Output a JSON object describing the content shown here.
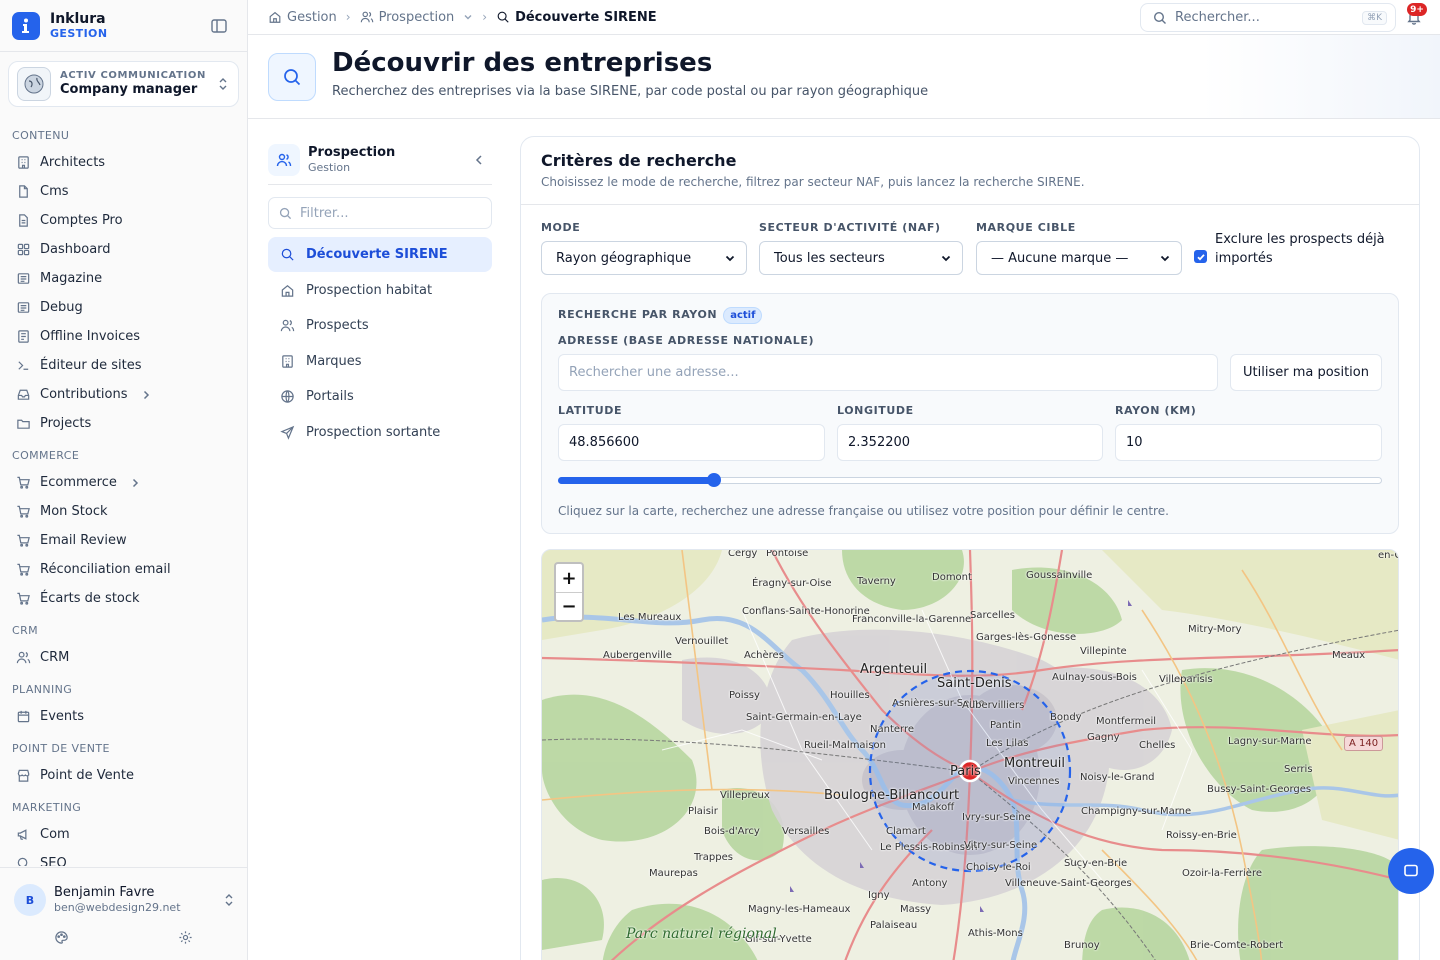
{
  "brand": {
    "name": "Inklura",
    "sub": "GESTION"
  },
  "org": {
    "kicker": "ACTIV COMMUNICATION",
    "name": "Company manager"
  },
  "sidebar": {
    "sections": [
      {
        "title": "CONTENU",
        "items": [
          {
            "label": "Architects",
            "icon": "building-icon"
          },
          {
            "label": "Cms",
            "icon": "file-icon"
          },
          {
            "label": "Comptes Pro",
            "icon": "file-text-icon"
          },
          {
            "label": "Dashboard",
            "icon": "dashboard-icon"
          },
          {
            "label": "Magazine",
            "icon": "newspaper-icon"
          },
          {
            "label": "Debug",
            "icon": "newspaper-icon"
          },
          {
            "label": "Offline Invoices",
            "icon": "invoice-icon"
          },
          {
            "label": "Éditeur de sites",
            "icon": "terminal-icon"
          },
          {
            "label": "Contributions",
            "icon": "inbox-icon",
            "chevron": true
          },
          {
            "label": "Projects",
            "icon": "folder-icon"
          }
        ]
      },
      {
        "title": "COMMERCE",
        "items": [
          {
            "label": "Ecommerce",
            "icon": "cart-icon",
            "chevron": true
          },
          {
            "label": "Mon Stock",
            "icon": "cart-icon"
          },
          {
            "label": "Email Review",
            "icon": "cart-icon"
          },
          {
            "label": "Réconciliation email",
            "icon": "cart-icon"
          },
          {
            "label": "Écarts de stock",
            "icon": "cart-icon"
          }
        ]
      },
      {
        "title": "CRM",
        "items": [
          {
            "label": "CRM",
            "icon": "users-icon"
          }
        ]
      },
      {
        "title": "PLANNING",
        "items": [
          {
            "label": "Events",
            "icon": "calendar-icon"
          }
        ]
      },
      {
        "title": "POINT DE VENTE",
        "items": [
          {
            "label": "Point de Vente",
            "icon": "store-icon"
          }
        ]
      },
      {
        "title": "MARKETING",
        "items": [
          {
            "label": "Com",
            "icon": "megaphone-icon"
          },
          {
            "label": "SEO",
            "icon": "search-icon"
          }
        ]
      }
    ]
  },
  "user": {
    "initial": "B",
    "name": "Benjamin Favre",
    "email": "ben@webdesign29.net"
  },
  "breadcrumb": [
    {
      "label": "Gestion",
      "icon": "home-icon"
    },
    {
      "label": "Prospection",
      "icon": "users-icon",
      "dropdown": true
    },
    {
      "label": "Découverte SIRENE",
      "icon": "search-icon",
      "current": true
    }
  ],
  "search": {
    "placeholder": "Rechercher...",
    "shortcut": "⌘K"
  },
  "notifications": {
    "badge": "9+"
  },
  "page": {
    "title": "Découvrir des entreprises",
    "subtitle": "Recherchez des entreprises via la base SIRENE, par code postal ou par rayon géographique"
  },
  "subnav": {
    "title": "Prospection",
    "subtitle": "Gestion",
    "filter_placeholder": "Filtrer...",
    "items": [
      {
        "label": "Découverte SIRENE",
        "icon": "search-icon",
        "active": true
      },
      {
        "label": "Prospection habitat",
        "icon": "home-icon"
      },
      {
        "label": "Prospects",
        "icon": "users-icon"
      },
      {
        "label": "Marques",
        "icon": "building-icon"
      },
      {
        "label": "Portails",
        "icon": "globe-icon"
      },
      {
        "label": "Prospection sortante",
        "icon": "send-icon"
      }
    ]
  },
  "criteria": {
    "title": "Critères de recherche",
    "subtitle": "Choisissez le mode de recherche, filtrez par secteur NAF, puis lancez la recherche SIRENE.",
    "mode": {
      "label": "MODE",
      "value": "Rayon géographique"
    },
    "sector": {
      "label": "SECTEUR D'ACTIVITÉ (NAF)",
      "value": "Tous les secteurs"
    },
    "brand": {
      "label": "MARQUE CIBLE",
      "value": "— Aucune marque —"
    },
    "exclude": {
      "label": "Exclure les prospects déjà importés",
      "checked": true
    },
    "radius": {
      "title": "RECHERCHE PAR RAYON",
      "badge": "actif",
      "address_label": "ADRESSE (BASE ADRESSE NATIONALE)",
      "address_placeholder": "Rechercher une adresse...",
      "use_position": "Utiliser ma position",
      "lat_label": "LATITUDE",
      "lat": "48.856600",
      "lng_label": "LONGITUDE",
      "lng": "2.352200",
      "km_label": "RAYON (KM)",
      "km": "10",
      "slider_fraction": 0.189,
      "hint": "Cliquez sur la carte, recherchez une adresse française ou utilisez votre position pour définir le centre."
    }
  },
  "map": {
    "zoom_in": "+",
    "zoom_out": "−",
    "labels": [
      "Cergy",
      "Pontoise",
      "Éragny-sur-Oise",
      "Conflans-Sainte-Honorine",
      "Les Mureaux",
      "Vernouillet",
      "Aubergenville",
      "Taverny",
      "Domont",
      "Goussainville",
      "en-Goële",
      "Franconville-la-Garenne",
      "Sarcelles",
      "Garges-lès-Gonesse",
      "Mitry-Mory",
      "Argenteuil",
      "Saint-Denis",
      "Achères",
      "Poissy",
      "Houilles",
      "Asnières-sur-Seine",
      "Aubervilliers",
      "Aulnay-sous-Bois",
      "Villepinte",
      "Villeparisis",
      "Meaux",
      "Saint-Germain-en-Laye",
      "Nanterre",
      "Pantin",
      "Bondy",
      "Montfermeil",
      "Rueil-Malmaison",
      "Les Lilas",
      "Gagny",
      "Chelles",
      "Lagny-sur-Marne",
      "Paris",
      "Montreuil",
      "Vincennes",
      "Noisy-le-Grand",
      "Serris",
      "Bussy-Saint-Georges",
      "Villepreux",
      "Boulogne-Billancourt",
      "Malakoff",
      "Plaisir",
      "Bois-d'Arcy",
      "Versailles",
      "Ivry-sur-Seine",
      "Champigny-sur-Marne",
      "Roissy-en-Brie",
      "Clamart",
      "Le Plessis-Robinson",
      "Vitry-sur-Seine",
      "Choisy-le-Roi",
      "Sucy-en-Brie",
      "Ozoir-la-Ferrière",
      "Trappes",
      "Maurepas",
      "Antony",
      "Igny",
      "Massy",
      "Villeneuve-Saint-Georges",
      "Magny-les-Hameaux",
      "Palaiseau",
      "Athis-Mons",
      "Gif-sur-Yvette",
      "Brunoy",
      "Brie-Comte-Robert",
      "Parc naturel régional"
    ],
    "road_shield": "A 140"
  }
}
